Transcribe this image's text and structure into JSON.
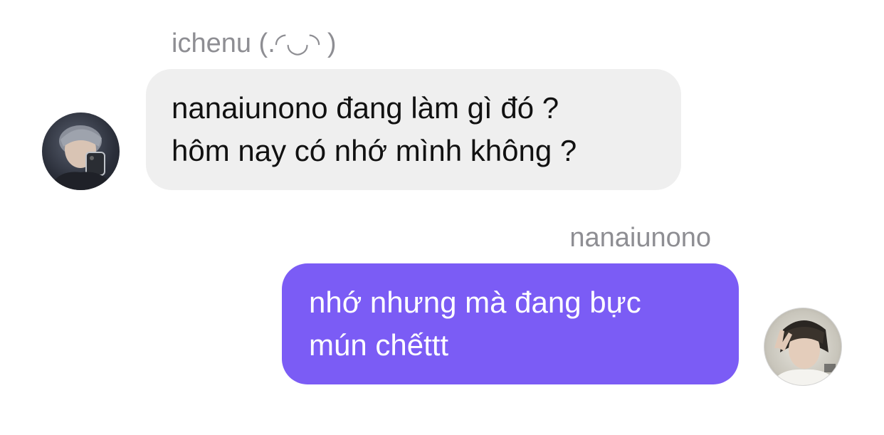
{
  "messages": [
    {
      "sender": "ichenu (.◜◡◝ )",
      "lines": [
        "nanaiunono đang làm gì đó ?",
        "hôm nay có nhớ mình không ?"
      ],
      "avatar_icon": "user-avatar-icon",
      "bubble_color": "#efefef"
    },
    {
      "sender": "nanaiunono",
      "lines": [
        "nhớ nhưng mà đang bực",
        "mún chếttt"
      ],
      "avatar_icon": "user-avatar-icon",
      "bubble_color": "#7b5cf5"
    }
  ]
}
